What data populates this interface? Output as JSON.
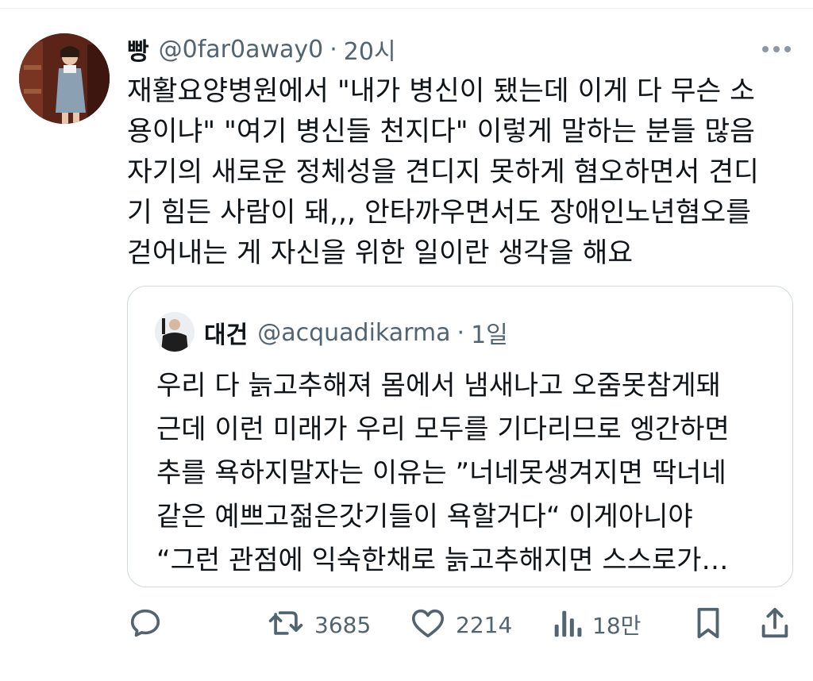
{
  "tweet": {
    "display_name": "빵",
    "handle": "@0far0away0",
    "separator": "·",
    "time": "20시",
    "text": "재활요양병원에서 \"내가 병신이 됐는데 이게 다 무슨 소\n용이냐\" \"여기 병신들 천지다\" 이렇게 말하는 분들 많음\n자기의 새로운 정체성을 견디지 못하게 혐오하면서 견디\n기 힘든 사람이 돼,,, 안타까우면서도 장애인노년혐오를\n걷어내는 게 자신을 위한 일이란 생각을 해요"
  },
  "quote": {
    "display_name": "대건",
    "handle": "@acquadikarma",
    "separator": "·",
    "time": "1일",
    "text": "우리 다 늙고추해져 몸에서 냄새나고 오줌못참게돼\n근데 이런 미래가 우리 모두를 기다리므로 엥간하면\n추를 욕하지말자는 이유는 ”너네못생겨지면 딱너네\n같은 예쁘고젊은갓기들이 욕할거다“ 이게아니야\n“그런 관점에 익숙한채로 늙고추해지면 스스로가…"
  },
  "actions": {
    "retweets": "3685",
    "likes": "2214",
    "views": "18만"
  },
  "icons": {
    "more": "more-icon",
    "reply": "reply-icon",
    "retweet": "retweet-icon",
    "like": "heart-icon",
    "views": "views-icon",
    "bookmark": "bookmark-icon",
    "share": "share-icon"
  },
  "colors": {
    "text": "#0f1419",
    "secondary": "#536471",
    "border": "#cfd9de"
  }
}
